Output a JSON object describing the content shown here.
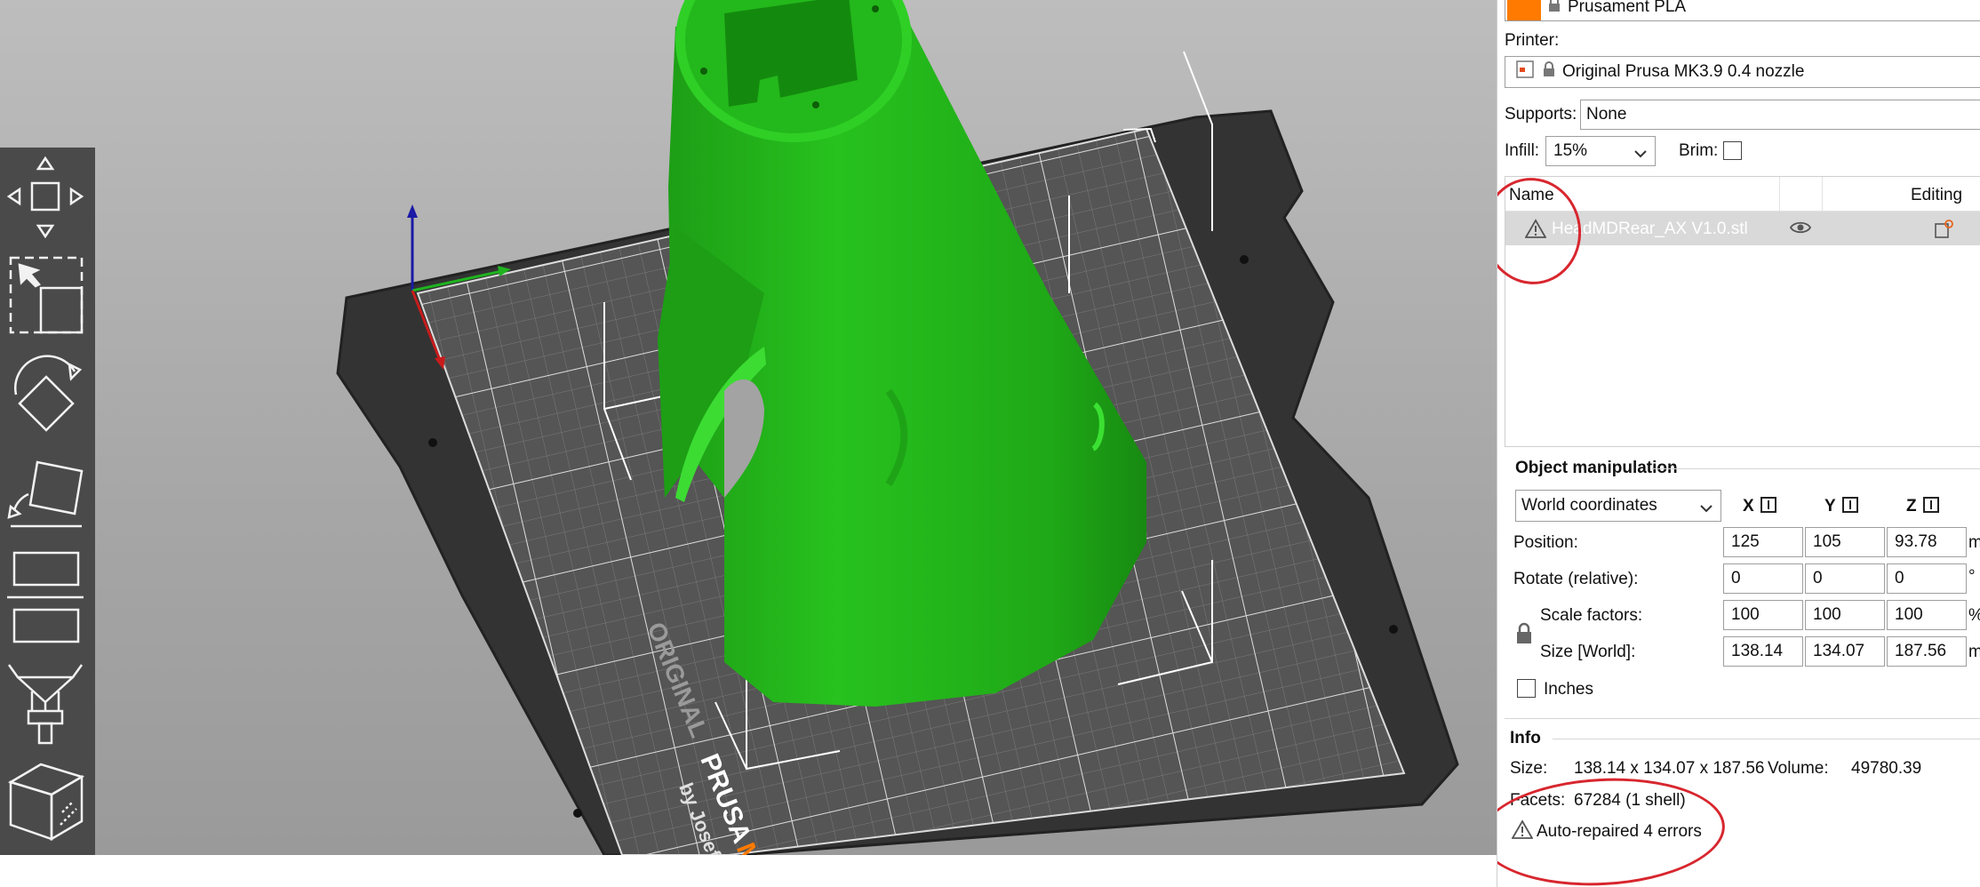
{
  "filament": {
    "name": "Prusament PLA",
    "color": "#ff7a00"
  },
  "printer": {
    "label": "Printer:",
    "name": "Original Prusa MK3.9 0.4 nozzle"
  },
  "supports": {
    "label": "Supports:",
    "value": "None"
  },
  "infill": {
    "label": "Infill:",
    "value": "15%"
  },
  "brim": {
    "label": "Brim:",
    "checked": false
  },
  "object_list": {
    "col_name": "Name",
    "col_editing": "Editing",
    "rows": [
      {
        "name": "HeadMDRear_AX V1.0.stl",
        "warning": true
      }
    ]
  },
  "object_manipulation": {
    "title": "Object manipulation",
    "coord_system": "World coordinates",
    "axes": [
      "X",
      "Y",
      "Z"
    ],
    "position": {
      "label": "Position:",
      "values": [
        "125",
        "105",
        "93.78"
      ],
      "unit": "m"
    },
    "rotate": {
      "label": "Rotate (relative):",
      "values": [
        "0",
        "0",
        "0"
      ],
      "unit": "°"
    },
    "scale": {
      "label": "Scale factors:",
      "values": [
        "100",
        "100",
        "100"
      ],
      "unit": "%"
    },
    "size": {
      "label": "Size [World]:",
      "values": [
        "138.14",
        "134.07",
        "187.56"
      ],
      "unit": "m"
    },
    "inches_label": "Inches"
  },
  "info": {
    "title": "Info",
    "size_label": "Size:",
    "size_value": "138.14 x 134.07 x 187.56",
    "volume_label": "Volume:",
    "volume_value": "49780.39",
    "facets_label": "Facets:",
    "facets_value": "67284 (1 shell)",
    "warning_text": "Auto-repaired 4 errors"
  },
  "bed": {
    "brand_line1": "ORIGINAL",
    "brand_line2": "PRUSA",
    "brand_line3": "MK",
    "brand_line4": "by Josef P"
  },
  "toolbar_icons": [
    "move-icon",
    "select-rectangle-icon",
    "rotate-icon",
    "place-on-face-icon",
    "cut-icon",
    "paint-supports-icon",
    "measure-cube-icon"
  ],
  "colors": {
    "model_green": "#22b71c",
    "annotation_red": "#d8262e",
    "bed_dark": "#3a3a3a"
  }
}
